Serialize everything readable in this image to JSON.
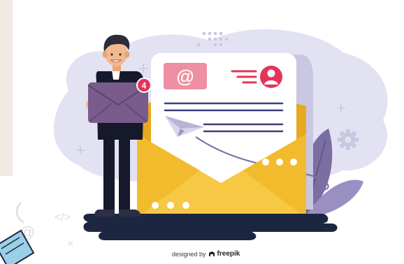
{
  "badge": {
    "count": "4"
  },
  "email_card": {
    "at_symbol": "@"
  },
  "code_symbols": {
    "code_tag": "</>",
    "at_sign": "@",
    "cross": "×"
  },
  "credit": {
    "prefix": "designed by",
    "brand": "freepik"
  },
  "icons": [
    "envelope-icon",
    "at-sign-icon",
    "user-avatar-icon",
    "paper-plane-icon",
    "gear-icon",
    "sparkle-icon",
    "notification-badge-icon",
    "freepik-logo-icon"
  ],
  "colors": {
    "background": "#f1e9e3",
    "panel": "#ffffff",
    "blob": "#e3e2f2",
    "envelope_yellow": "#f6c843",
    "envelope_dark": "#e8a91f",
    "letter": "#ffffff",
    "accent_red": "#e4345a",
    "accent_pink": "#ee8fa3",
    "navy": "#1c2641",
    "purple": "#7a6ea3",
    "suit": "#15192b",
    "skin": "#f3b98c",
    "hair": "#2c2b3c"
  }
}
